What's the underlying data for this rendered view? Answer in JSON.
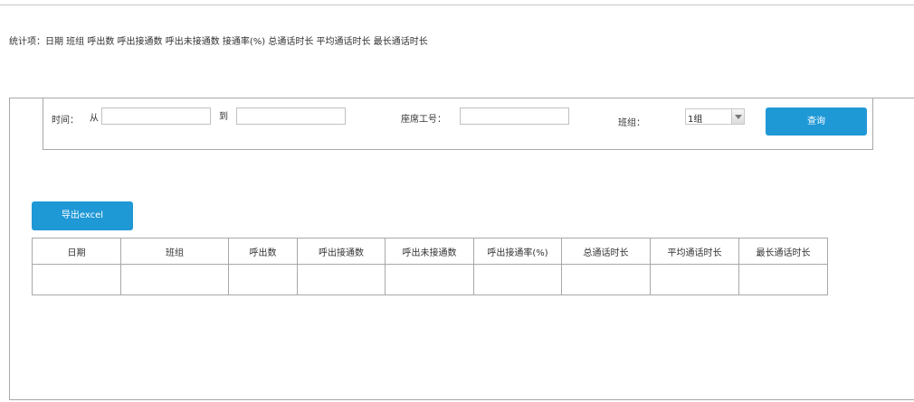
{
  "stats_line": "统计项：日期 班组 呼出数 呼出接通数 呼出未接通数 接通率(%) 总通话时长 平均通话时长 最长通话时长",
  "filters": {
    "time_label": "时间：",
    "from_label": "从",
    "to_label": "到",
    "from_value": "",
    "to_value": "",
    "seat_label": "座席工号：",
    "seat_value": "",
    "group_label": "班组：",
    "group_selected": "1组",
    "query_label": "查询"
  },
  "export_label": "导出excel",
  "table": {
    "headers": [
      "日期",
      "班组",
      "呼出数",
      "呼出接通数",
      "呼出未接通数",
      "呼出接通率(%)",
      "总通话时长",
      "平均通话时长",
      "最长通话时长"
    ],
    "rows": [
      [
        "",
        "",
        "",
        "",
        "",
        "",
        "",
        "",
        ""
      ]
    ]
  },
  "colors": {
    "accent": "#1f98d6",
    "border": "#a8a8a8"
  },
  "icons": {
    "dropdown": "chevron-down-icon"
  }
}
